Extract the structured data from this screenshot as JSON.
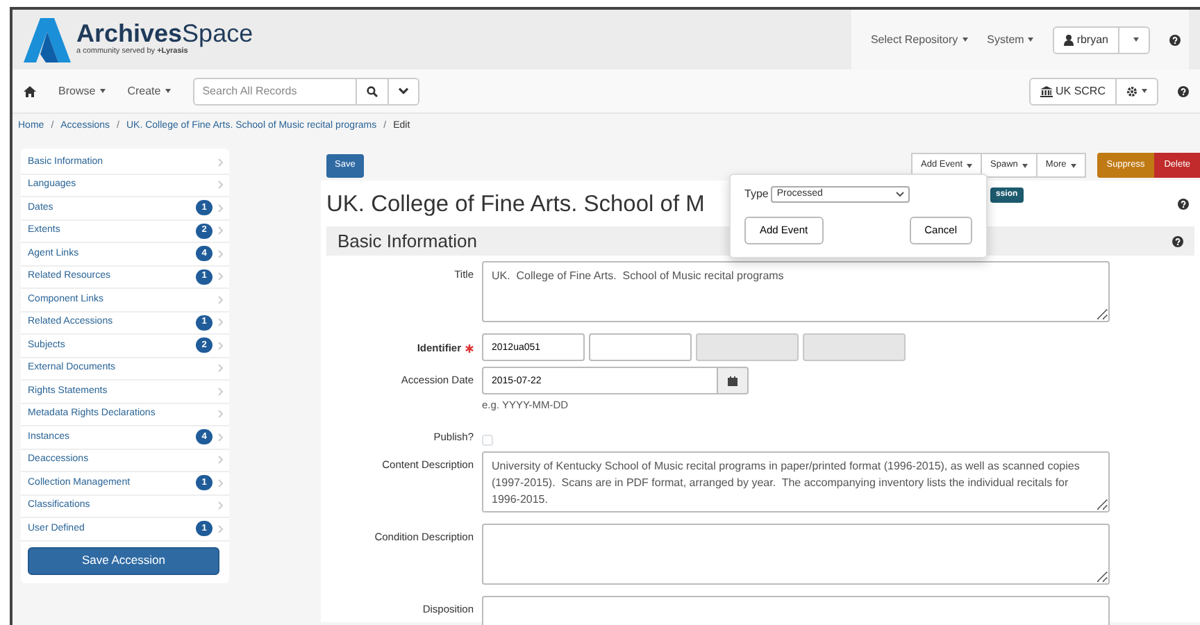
{
  "header": {
    "brand_bold": "Archives",
    "brand_light": "Space",
    "tagline": "a community served by",
    "tagline_org": "+Lyrasis",
    "menu": [
      {
        "label": "Select Repository"
      },
      {
        "label": "System"
      }
    ],
    "user": "rbryan"
  },
  "nav": {
    "menu": [
      {
        "label": "Browse"
      },
      {
        "label": "Create"
      }
    ],
    "search": {
      "placeholder": "Search All Records"
    },
    "repository": "UK SCRC"
  },
  "breadcrumb": {
    "items": [
      "Home",
      "Accessions",
      "UK. College of Fine Arts. School of Music recital programs",
      "Edit"
    ],
    "separators": [
      "/",
      "/",
      "/"
    ]
  },
  "sidebar": {
    "items": [
      {
        "label": "Basic Information"
      },
      {
        "label": "Languages"
      },
      {
        "label": "Dates",
        "count": "1"
      },
      {
        "label": "Extents",
        "count": "2"
      },
      {
        "label": "Agent Links",
        "count": "4"
      },
      {
        "label": "Related Resources",
        "count": "1"
      },
      {
        "label": "Component Links"
      },
      {
        "label": "Related Accessions",
        "count": "1"
      },
      {
        "label": "Subjects",
        "count": "2"
      },
      {
        "label": "External Documents"
      },
      {
        "label": "Rights Statements"
      },
      {
        "label": "Metadata Rights Declarations"
      },
      {
        "label": "Instances",
        "count": "4"
      },
      {
        "label": "Deaccessions"
      },
      {
        "label": "Collection Management",
        "count": "1"
      },
      {
        "label": "Classifications"
      },
      {
        "label": "User Defined",
        "count": "1"
      }
    ],
    "save_button": "Save Accession"
  },
  "toolbar": {
    "save": "Save",
    "menus": [
      {
        "label": "Add Event"
      },
      {
        "label": "Spawn"
      },
      {
        "label": "More"
      }
    ],
    "suppress": "Suppress",
    "delete": "Delete"
  },
  "record": {
    "title": "UK. College of Fine Arts. School of M",
    "badge": "ssion"
  },
  "popover": {
    "type_label": "Type",
    "type_value": "Processed",
    "add_button": "Add Event",
    "cancel_button": "Cancel"
  },
  "section": {
    "title": "Basic Information"
  },
  "form": {
    "fields": [
      {
        "kind": "textarea",
        "label": "Title",
        "value": "UK.  College of Fine Arts.  School of Music recital programs"
      },
      {
        "kind": "identifier",
        "label": "Identifier",
        "required": true,
        "parts": [
          {
            "value": "2012ua051",
            "disabled": false
          },
          {
            "disabled": false
          },
          {
            "disabled": true
          },
          {
            "disabled": true
          }
        ]
      },
      {
        "kind": "date",
        "label": "Accession Date",
        "value": "2015-07-22",
        "hint": "e.g. YYYY-MM-DD"
      },
      {
        "kind": "checkbox",
        "label": "Publish?",
        "checked": false
      },
      {
        "kind": "textarea",
        "label": "Content Description",
        "value": "University of Kentucky School of Music recital programs in paper/printed format (1996-2015), as well as scanned copies (1997-2015).  Scans are in PDF format, arranged by year.  The accompanying inventory lists the individual recitals for 1996-2015."
      },
      {
        "kind": "textarea",
        "label": "Condition Description"
      },
      {
        "kind": "textarea",
        "label": "Disposition"
      }
    ]
  }
}
